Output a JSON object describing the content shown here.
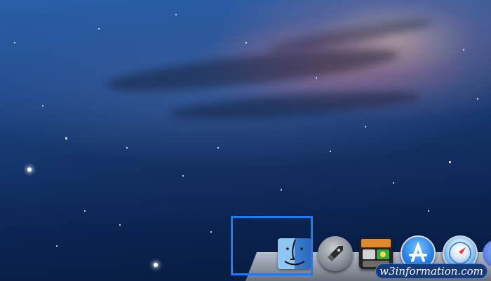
{
  "desktop": {
    "wallpaper": "galaxy"
  },
  "dock": {
    "items": [
      {
        "name": "Finder",
        "icon": "finder-icon",
        "highlighted": true
      },
      {
        "name": "Launchpad",
        "icon": "rocket-icon"
      },
      {
        "name": "Dashboard",
        "icon": "dashboard-icon"
      },
      {
        "name": "App Store",
        "icon": "app-store-icon"
      },
      {
        "name": "Safari",
        "icon": "safari-compass-icon"
      },
      {
        "name": "Application",
        "icon": "app-icon-partial"
      }
    ]
  },
  "highlight": {
    "color": "#1f7cf0",
    "target": "Finder"
  },
  "watermark": {
    "text": "w3information.com"
  },
  "colors": {
    "highlight_border": "#1f7cf0",
    "watermark_bg": "#173a78"
  }
}
